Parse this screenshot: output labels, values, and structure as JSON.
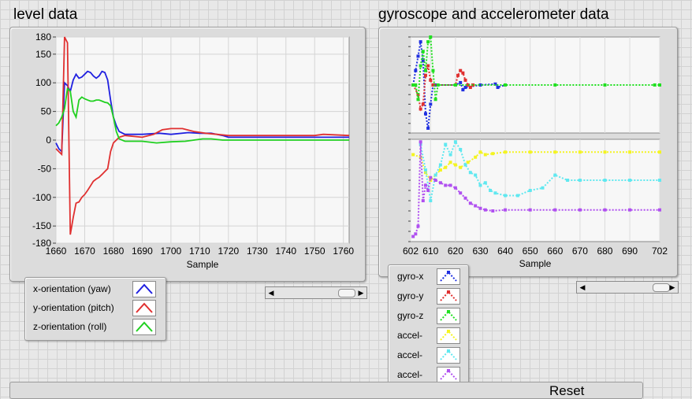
{
  "level": {
    "title": "level data",
    "chart_data": {
      "type": "line",
      "xlabel": "Sample",
      "ylabel": "",
      "xlim": [
        1660,
        1762
      ],
      "ylim": [
        -180,
        180
      ],
      "x_ticks": [
        1660,
        1670,
        1680,
        1690,
        1700,
        1710,
        1720,
        1730,
        1740,
        1750,
        1760
      ],
      "y_ticks": [
        180,
        150,
        100,
        50,
        0,
        -50,
        -100,
        -150,
        -180
      ],
      "grid": true,
      "series": [
        {
          "name": "x-orientation (yaw)",
          "color": "#2020e0",
          "points": [
            [
              1660,
              -5
            ],
            [
              1661,
              -15
            ],
            [
              1662,
              -20
            ],
            [
              1663,
              100
            ],
            [
              1664,
              95
            ],
            [
              1665,
              85
            ],
            [
              1666,
              105
            ],
            [
              1667,
              115
            ],
            [
              1668,
              108
            ],
            [
              1669,
              110
            ],
            [
              1670,
              115
            ],
            [
              1671,
              120
            ],
            [
              1672,
              118
            ],
            [
              1673,
              112
            ],
            [
              1674,
              108
            ],
            [
              1675,
              112
            ],
            [
              1676,
              120
            ],
            [
              1677,
              118
            ],
            [
              1678,
              105
            ],
            [
              1679,
              70
            ],
            [
              1680,
              40
            ],
            [
              1681,
              25
            ],
            [
              1682,
              15
            ],
            [
              1684,
              10
            ],
            [
              1690,
              10
            ],
            [
              1696,
              12
            ],
            [
              1700,
              10
            ],
            [
              1706,
              13
            ],
            [
              1710,
              12
            ],
            [
              1714,
              12
            ],
            [
              1718,
              8
            ],
            [
              1720,
              5
            ],
            [
              1730,
              5
            ],
            [
              1740,
              5
            ],
            [
              1750,
              5
            ],
            [
              1755,
              5
            ],
            [
              1762,
              5
            ]
          ]
        },
        {
          "name": "y-orientation (pitch)",
          "color": "#e03030",
          "points": [
            [
              1660,
              -15
            ],
            [
              1661,
              -20
            ],
            [
              1662,
              -25
            ],
            [
              1663,
              180
            ],
            [
              1664,
              170
            ],
            [
              1665,
              -165
            ],
            [
              1666,
              -135
            ],
            [
              1667,
              -110
            ],
            [
              1668,
              -108
            ],
            [
              1669,
              -100
            ],
            [
              1670,
              -95
            ],
            [
              1671,
              -88
            ],
            [
              1672,
              -80
            ],
            [
              1673,
              -72
            ],
            [
              1674,
              -68
            ],
            [
              1675,
              -65
            ],
            [
              1676,
              -60
            ],
            [
              1677,
              -55
            ],
            [
              1678,
              -50
            ],
            [
              1679,
              -20
            ],
            [
              1680,
              -5
            ],
            [
              1681,
              0
            ],
            [
              1682,
              5
            ],
            [
              1684,
              8
            ],
            [
              1690,
              5
            ],
            [
              1694,
              10
            ],
            [
              1697,
              18
            ],
            [
              1700,
              20
            ],
            [
              1704,
              20
            ],
            [
              1708,
              15
            ],
            [
              1712,
              12
            ],
            [
              1716,
              10
            ],
            [
              1720,
              8
            ],
            [
              1730,
              8
            ],
            [
              1740,
              8
            ],
            [
              1750,
              8
            ],
            [
              1753,
              10
            ],
            [
              1762,
              8
            ]
          ]
        },
        {
          "name": "z-orientation (roll)",
          "color": "#20d020",
          "points": [
            [
              1660,
              25
            ],
            [
              1661,
              30
            ],
            [
              1662,
              40
            ],
            [
              1663,
              55
            ],
            [
              1664,
              90
            ],
            [
              1665,
              85
            ],
            [
              1666,
              50
            ],
            [
              1667,
              40
            ],
            [
              1668,
              70
            ],
            [
              1669,
              75
            ],
            [
              1670,
              72
            ],
            [
              1671,
              70
            ],
            [
              1672,
              68
            ],
            [
              1673,
              68
            ],
            [
              1674,
              70
            ],
            [
              1675,
              70
            ],
            [
              1676,
              68
            ],
            [
              1677,
              66
            ],
            [
              1678,
              65
            ],
            [
              1679,
              60
            ],
            [
              1680,
              40
            ],
            [
              1681,
              15
            ],
            [
              1682,
              2
            ],
            [
              1684,
              -2
            ],
            [
              1690,
              -2
            ],
            [
              1695,
              -5
            ],
            [
              1700,
              -3
            ],
            [
              1705,
              -2
            ],
            [
              1708,
              0
            ],
            [
              1711,
              2
            ],
            [
              1714,
              2
            ],
            [
              1718,
              0
            ],
            [
              1720,
              0
            ],
            [
              1730,
              0
            ],
            [
              1740,
              0
            ],
            [
              1750,
              0
            ],
            [
              1762,
              0
            ]
          ]
        }
      ]
    },
    "legend": [
      {
        "label": "x-orientation (yaw)",
        "color": "#2020e0"
      },
      {
        "label": "y-orientation (pitch)",
        "color": "#e03030"
      },
      {
        "label": "z-orientation (roll)",
        "color": "#20d020"
      }
    ]
  },
  "imu": {
    "title": "gyroscope and accelerometer data",
    "chart_data": {
      "type": "scatter",
      "xlabel": "Sample",
      "xlim": [
        602,
        702
      ],
      "x_ticks": [
        602,
        610,
        620,
        630,
        640,
        650,
        660,
        670,
        680,
        690,
        702
      ],
      "x_tick_labels": [
        "602",
        "610",
        "620",
        "630",
        "640",
        "650",
        "660",
        "670",
        "680",
        "690",
        "702"
      ],
      "gyro_ylim": [
        -1,
        1
      ],
      "gyro_series": [
        {
          "name": "gyro-x",
          "color": "#2030e0",
          "points": [
            [
              603,
              0
            ],
            [
              604,
              0.3
            ],
            [
              605,
              0.6
            ],
            [
              606,
              0.9
            ],
            [
              607,
              0.5
            ],
            [
              608,
              -0.6
            ],
            [
              609,
              -0.9
            ],
            [
              610,
              -0.4
            ],
            [
              611,
              0
            ],
            [
              612,
              0
            ],
            [
              620,
              0
            ],
            [
              622,
              0.05
            ],
            [
              623,
              -0.1
            ],
            [
              624,
              -0.05
            ],
            [
              630,
              0
            ],
            [
              636,
              0.02
            ],
            [
              637,
              -0.05
            ],
            [
              640,
              0
            ]
          ]
        },
        {
          "name": "gyro-y",
          "color": "#e03030",
          "points": [
            [
              603,
              0
            ],
            [
              605,
              -0.2
            ],
            [
              606,
              -0.5
            ],
            [
              607,
              -0.4
            ],
            [
              608,
              0.2
            ],
            [
              609,
              0.4
            ],
            [
              610,
              0.1
            ],
            [
              611,
              0
            ],
            [
              620,
              0
            ],
            [
              621,
              0.2
            ],
            [
              622,
              0.3
            ],
            [
              623,
              0.25
            ],
            [
              624,
              0.1
            ],
            [
              625,
              0
            ],
            [
              626,
              -0.05
            ],
            [
              627,
              0
            ]
          ]
        },
        {
          "name": "gyro-z",
          "color": "#20e020",
          "points": [
            [
              603,
              0
            ],
            [
              604,
              0
            ],
            [
              605,
              -0.3
            ],
            [
              606,
              0.4
            ],
            [
              607,
              0.7
            ],
            [
              608,
              0.3
            ],
            [
              609,
              0.9
            ],
            [
              610,
              1.0
            ],
            [
              611,
              0.3
            ],
            [
              612,
              -0.3
            ],
            [
              613,
              0
            ],
            [
              620,
              0
            ],
            [
              640,
              0
            ],
            [
              660,
              0
            ],
            [
              680,
              0
            ],
            [
              700,
              0
            ],
            [
              702,
              0
            ]
          ]
        }
      ],
      "accel_ylim": [
        -1,
        1
      ],
      "accel_series": [
        {
          "name": "accel-",
          "color": "#f4f420",
          "points": [
            [
              603,
              0.7
            ],
            [
              606,
              0.65
            ],
            [
              608,
              0.35
            ],
            [
              610,
              0.2
            ],
            [
              612,
              0.3
            ],
            [
              614,
              0.4
            ],
            [
              616,
              0.45
            ],
            [
              618,
              0.55
            ],
            [
              620,
              0.5
            ],
            [
              622,
              0.45
            ],
            [
              625,
              0.55
            ],
            [
              628,
              0.65
            ],
            [
              630,
              0.75
            ],
            [
              632,
              0.7
            ],
            [
              635,
              0.72
            ],
            [
              640,
              0.75
            ],
            [
              650,
              0.75
            ],
            [
              660,
              0.75
            ],
            [
              670,
              0.75
            ],
            [
              680,
              0.75
            ],
            [
              690,
              0.75
            ],
            [
              702,
              0.75
            ]
          ]
        },
        {
          "name": "accel-",
          "color": "#60e8f0",
          "points": [
            [
              606,
              0.9
            ],
            [
              608,
              0.4
            ],
            [
              610,
              -0.2
            ],
            [
              612,
              0.3
            ],
            [
              614,
              0.5
            ],
            [
              616,
              0.9
            ],
            [
              618,
              0.7
            ],
            [
              620,
              0.95
            ],
            [
              622,
              0.8
            ],
            [
              624,
              0.5
            ],
            [
              626,
              0.35
            ],
            [
              628,
              0.3
            ],
            [
              630,
              0.1
            ],
            [
              632,
              0.15
            ],
            [
              634,
              0.0
            ],
            [
              636,
              -0.05
            ],
            [
              640,
              -0.1
            ],
            [
              645,
              -0.1
            ],
            [
              650,
              0.0
            ],
            [
              655,
              0.05
            ],
            [
              660,
              0.3
            ],
            [
              665,
              0.2
            ],
            [
              670,
              0.2
            ],
            [
              680,
              0.2
            ],
            [
              690,
              0.2
            ],
            [
              702,
              0.2
            ]
          ]
        },
        {
          "name": "accel-",
          "color": "#b050f0",
          "points": [
            [
              603,
              -0.9
            ],
            [
              604,
              -0.85
            ],
            [
              605,
              -0.7
            ],
            [
              606,
              0.95
            ],
            [
              607,
              -0.2
            ],
            [
              608,
              0.1
            ],
            [
              609,
              0.0
            ],
            [
              610,
              0.25
            ],
            [
              612,
              0.2
            ],
            [
              614,
              0.15
            ],
            [
              616,
              0.1
            ],
            [
              618,
              0.1
            ],
            [
              620,
              0.05
            ],
            [
              622,
              -0.05
            ],
            [
              624,
              -0.15
            ],
            [
              626,
              -0.25
            ],
            [
              628,
              -0.3
            ],
            [
              630,
              -0.35
            ],
            [
              632,
              -0.38
            ],
            [
              635,
              -0.4
            ],
            [
              640,
              -0.38
            ],
            [
              650,
              -0.38
            ],
            [
              660,
              -0.38
            ],
            [
              670,
              -0.38
            ],
            [
              680,
              -0.38
            ],
            [
              690,
              -0.38
            ],
            [
              702,
              -0.38
            ]
          ]
        }
      ]
    },
    "legend": [
      {
        "label": "gyro-x",
        "color": "#2030e0"
      },
      {
        "label": "gyro-y",
        "color": "#e03030"
      },
      {
        "label": "gyro-z",
        "color": "#20e020"
      },
      {
        "label": "accel-",
        "color": "#f4f420"
      },
      {
        "label": "accel-",
        "color": "#60e8f0"
      },
      {
        "label": "accel-",
        "color": "#b050f0"
      }
    ]
  },
  "partial_label": "Reset"
}
